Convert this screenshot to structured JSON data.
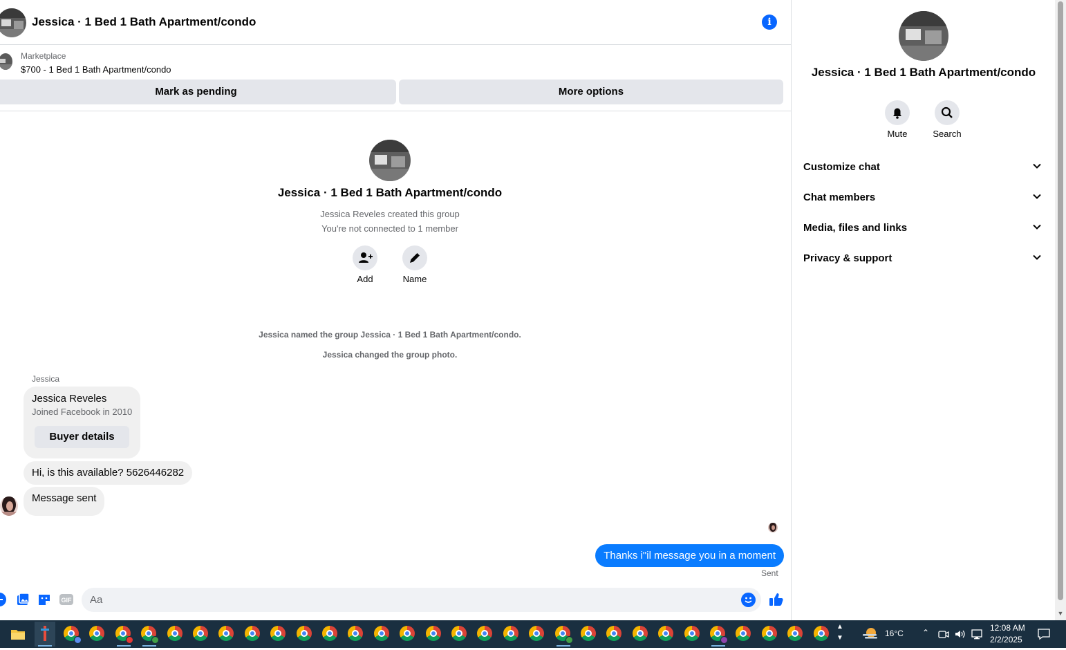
{
  "header": {
    "title": "Jessica · 1 Bed 1 Bath Apartment/condo"
  },
  "marketplace": {
    "label": "Marketplace",
    "listing": "$700 - 1 Bed 1 Bath Apartment/condo",
    "mark_pending_label": "Mark as pending",
    "more_options_label": "More options"
  },
  "intro": {
    "title": "Jessica · 1 Bed 1 Bath Apartment/condo",
    "created_by": "Jessica Reveles created this group",
    "connection": "You're not connected to 1 member",
    "add_label": "Add",
    "name_label": "Name"
  },
  "system_messages": [
    "Jessica named the group Jessica · 1 Bed 1 Bath Apartment/condo.",
    "Jessica changed the group photo."
  ],
  "messages": {
    "sender": "Jessica",
    "buyer_card": {
      "name": "Jessica Reveles",
      "joined": "Joined Facebook in 2010",
      "button": "Buyer details"
    },
    "incoming": [
      "Hi, is this available? 5626446282",
      "Message sent"
    ],
    "outgoing": "Thanks i\"il message you in a moment",
    "status": "Sent"
  },
  "composer": {
    "placeholder": "Aa"
  },
  "side": {
    "title": "Jessica · 1 Bed 1 Bath Apartment/condo",
    "mute_label": "Mute",
    "search_label": "Search",
    "sections": [
      "Customize chat",
      "Chat members",
      "Media, files and links",
      "Privacy & support"
    ]
  },
  "taskbar": {
    "weather": "16°C",
    "time": "12:08 AM",
    "date": "2/2/2025"
  },
  "colors": {
    "accent": "#0866ff",
    "outgoing_bubble": "#0a7cff",
    "taskbar": "#1a2f40"
  }
}
